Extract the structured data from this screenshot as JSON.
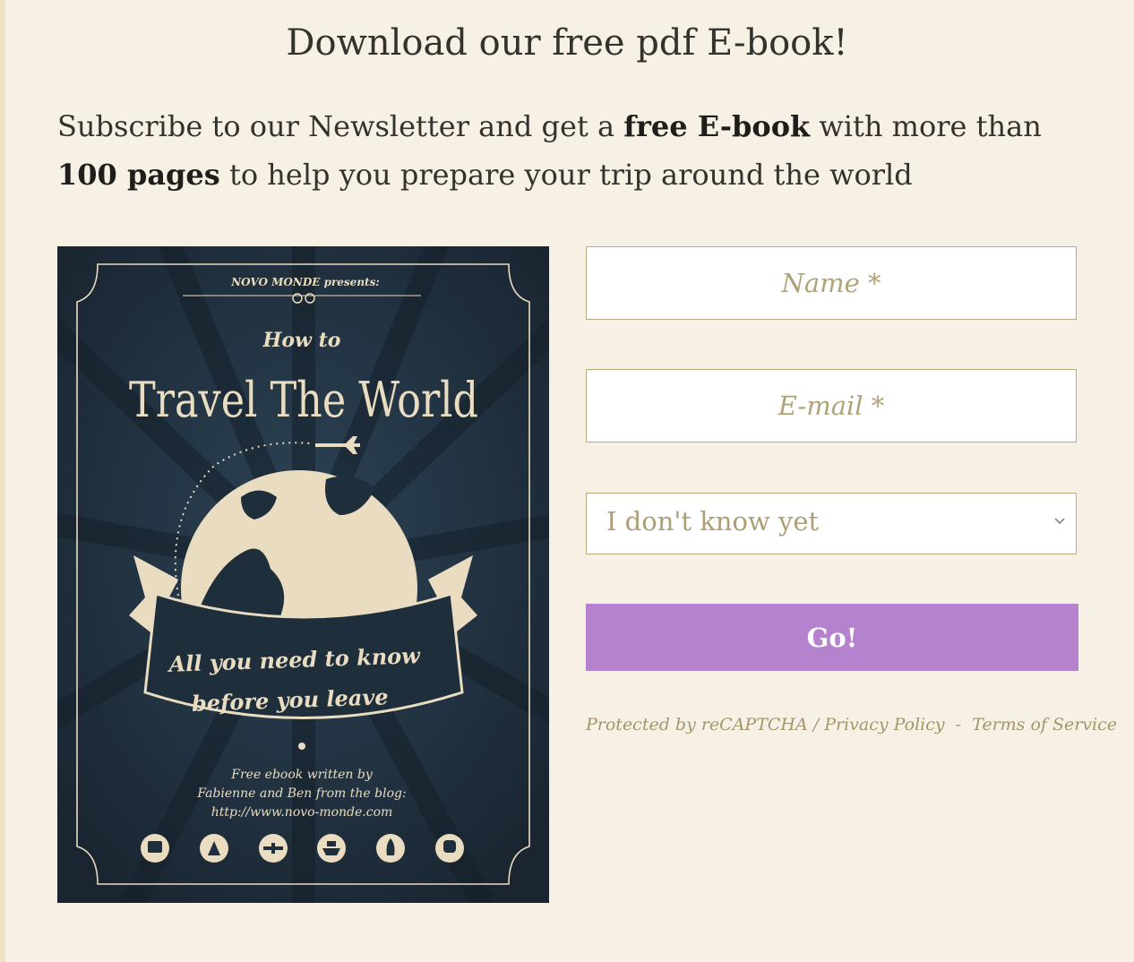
{
  "heading": "Download our free pdf E-book!",
  "intro": {
    "part1": "Subscribe to our Newsletter and get a ",
    "bold1": "free E-book",
    "part2": " with more than ",
    "bold2": "100 pages",
    "part3": " to help you prepare your trip around the world"
  },
  "cover": {
    "presents": "NOVO MONDE presents:",
    "how_to": "How to",
    "title": "Travel The World",
    "banner_line1": "All you need to know",
    "banner_line2": "before you leave",
    "credit_line1": "Free ebook written by",
    "credit_line2": "Fabienne and Ben from the blog:",
    "credit_line3": "http://www.novo-monde.com",
    "transport_icons": [
      "bus-icon",
      "scooter-icon",
      "plane-icon",
      "ship-icon",
      "rocket-icon",
      "train-icon"
    ]
  },
  "form": {
    "name_placeholder": "Name *",
    "email_placeholder": "E-mail *",
    "select_value": "I don't know yet",
    "submit_label": "Go!",
    "legal": {
      "protected": "Protected by reCAPTCHA /",
      "privacy": "Privacy Policy",
      "dash": "-",
      "terms": "Terms of Service"
    }
  },
  "colors": {
    "background": "#f6f1e4",
    "accent_button": "#b582cd",
    "input_border": "#b9ab7f",
    "placeholder": "#b1a277",
    "cover_navy": "#1d2a35",
    "cover_cream": "#e9dcc0"
  }
}
